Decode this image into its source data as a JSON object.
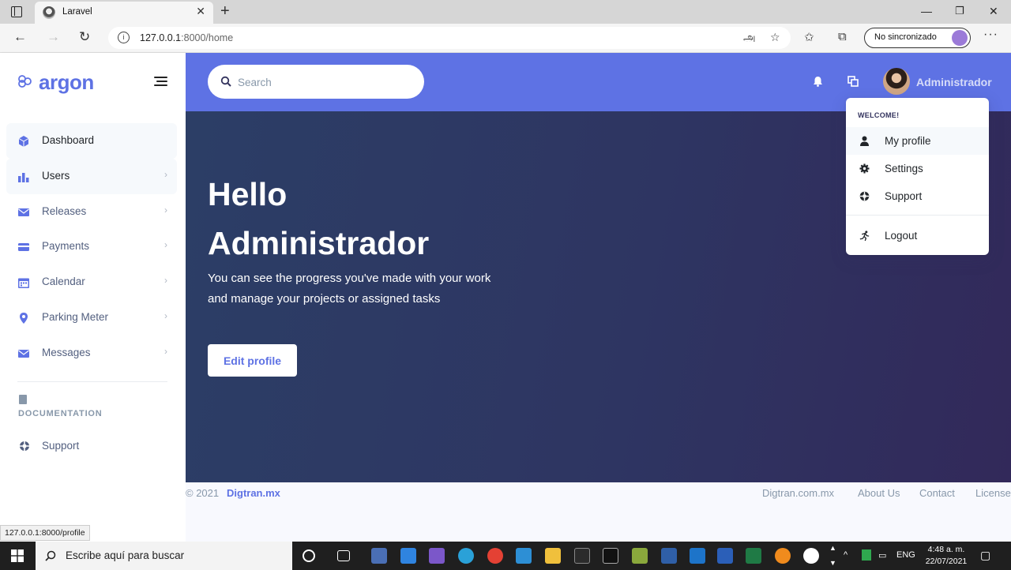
{
  "browser": {
    "tab_title": "Laravel",
    "url_host": "127.0.0.1",
    "url_path": ":8000/home",
    "sync_label": "No sincronizado",
    "status_url": "127.0.0.1:8000/profile"
  },
  "sidebar": {
    "brand": "argon",
    "items": [
      {
        "label": "Dashboard",
        "icon": "cube-icon",
        "color": "#5e72e4"
      },
      {
        "label": "Users",
        "icon": "chart-bar-icon",
        "color": "#5e72e4"
      },
      {
        "label": "Releases",
        "icon": "envelope-icon",
        "color": "#5e72e4"
      },
      {
        "label": "Payments",
        "icon": "credit-card-icon",
        "color": "#5e72e4"
      },
      {
        "label": "Calendar",
        "icon": "calendar-icon",
        "color": "#5e72e4"
      },
      {
        "label": "Parking Meter",
        "icon": "map-pin-icon",
        "color": "#5e72e4"
      },
      {
        "label": "Messages",
        "icon": "envelope-icon",
        "color": "#5e72e4"
      }
    ],
    "doc_heading": "DOCUMENTATION",
    "support_label": "Support"
  },
  "topbar": {
    "search_placeholder": "Search",
    "user_name": "Administrador"
  },
  "dropdown": {
    "header": "WELCOME!",
    "items": [
      {
        "label": "My profile",
        "icon": "user-icon"
      },
      {
        "label": "Settings",
        "icon": "gear-icon"
      },
      {
        "label": "Support",
        "icon": "lifebuoy-icon"
      },
      {
        "label": "Logout",
        "icon": "running-icon"
      }
    ]
  },
  "hero": {
    "title_line1": "Hello",
    "title_line2": "Administrador",
    "text": "You can see the progress you've made with your work and manage your projects or assigned tasks",
    "button": "Edit profile"
  },
  "footer": {
    "copyright": "© 2021",
    "company": "Digtran.mx",
    "links": [
      "Digtran.com.mx",
      "About Us",
      "Contact",
      "License"
    ]
  },
  "taskbar": {
    "search_text": "Escribe aquí para buscar",
    "lang": "ENG",
    "time": "4:48 a. m.",
    "date": "22/07/2021"
  },
  "colors": {
    "primary": "#5e72e4",
    "hero_bg": "#2e3562",
    "text_muted": "#8898aa"
  }
}
